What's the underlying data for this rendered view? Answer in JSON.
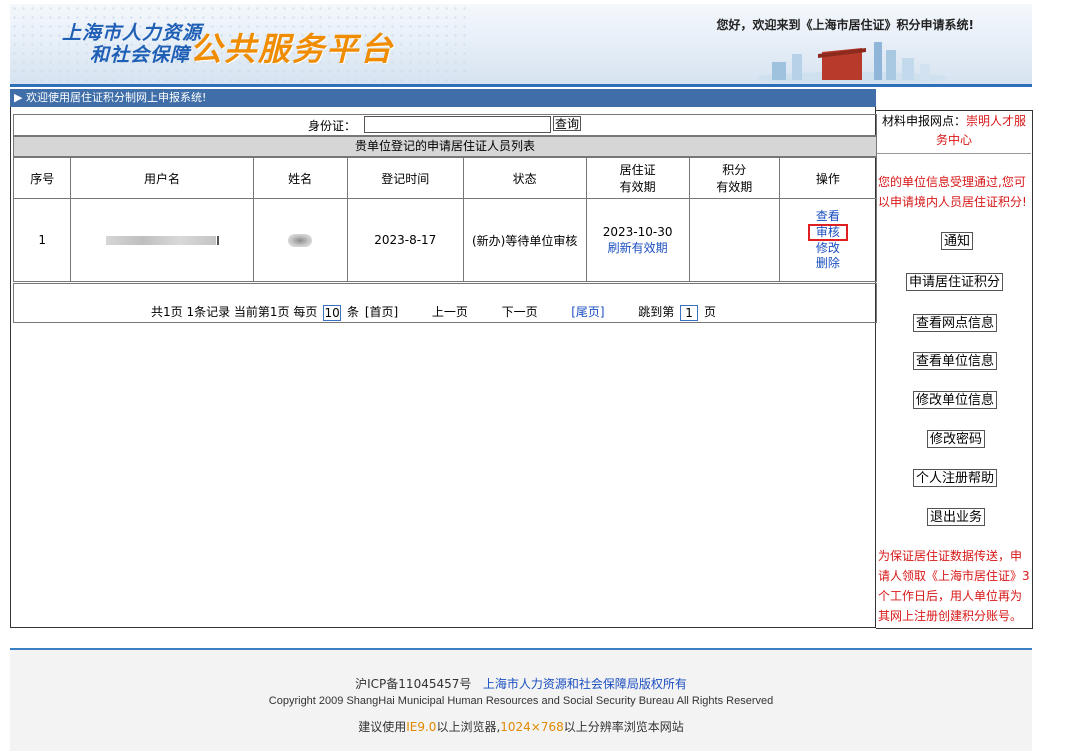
{
  "header": {
    "logo_line1": "上海市人力资源",
    "logo_line2": "和社会保障",
    "logo_brand": "公共服务平台",
    "welcome": "您好，欢迎来到《上海市居住证》积分申请系统!"
  },
  "main": {
    "bar_title": "▶ 欢迎使用居住证积分制网上申报系统!",
    "search": {
      "label": "身份证：",
      "value": "",
      "button": "查询"
    },
    "list_title": "贵单位登记的申请居住证人员列表",
    "columns": [
      "序号",
      "用户名",
      "姓名",
      "登记时间",
      "状态",
      "居住证有效期",
      "积分有效期",
      "操作"
    ],
    "col_residence_line1": "居住证",
    "col_residence_line2": "有效期",
    "col_points_line1": "积分",
    "col_points_line2": "有效期",
    "rows": [
      {
        "index": "1",
        "username_tail": "\\",
        "reg_date": "2023-8-17",
        "status": "(新办)等待单位审核",
        "residence_expiry": "2023-10-30",
        "refresh_link": "刷新有效期",
        "points_expiry": "",
        "ops": [
          "查看",
          "审核",
          "修改",
          "删除"
        ]
      }
    ],
    "pager": {
      "summary": "共1页 1条记录 当前第1页 每页",
      "per_page": "10",
      "unit": "条",
      "first": "[首页]",
      "prev": "上一页",
      "next": "下一页",
      "last": "[尾页]",
      "jump_label": "跳到第",
      "jump_value": "1",
      "page_word": "页"
    }
  },
  "sidebar": {
    "point_label": "材料申报网点：",
    "point_value": "崇明人才服务中心",
    "approve_text": "您的单位信息受理通过,您可以申请境内人员居住证积分!",
    "buttons": [
      "通知",
      "申请居住证积分",
      "查看网点信息",
      "查看单位信息",
      "修改单位信息",
      "修改密码",
      "个人注册帮助",
      "退出业务"
    ],
    "warning": "为保证居住证数据传送，申请人领取《上海市居住证》3个工作日后，用人单位再为其网上注册创建积分账号。"
  },
  "footer": {
    "icp": "沪ICP备11045457号",
    "copyright_cn": "上海市人力资源和社会保障局版权所有",
    "copyright_en": "Copyright 2009 ShangHai Municipal Human Resources and Social Security Bureau All Rights Reserved",
    "suggest_pre": "建议使用",
    "browser": "IE9.0",
    "suggest_mid": "以上浏览器,",
    "resolution": "1024×768",
    "suggest_post": "以上分辨率浏览本网站"
  },
  "colors": {
    "link": "#1a4fc0",
    "alert": "#d71818",
    "header_bar": "#3f6ea8",
    "brand_orange": "#f08c00"
  }
}
